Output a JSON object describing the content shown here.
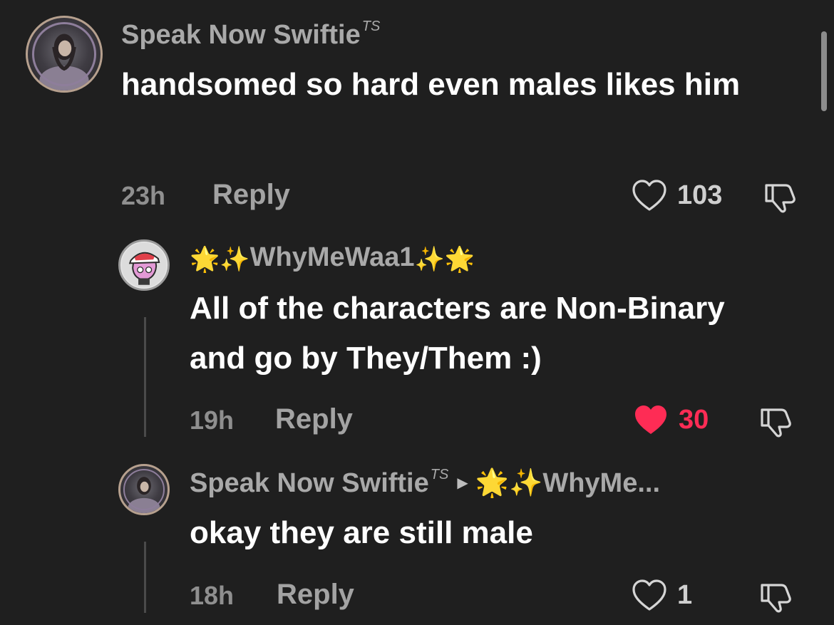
{
  "comments": [
    {
      "username": "Speak Now Swiftie",
      "badge": "TS",
      "text": "handsomed so hard even males likes him",
      "time": "23h",
      "reply_label": "Reply",
      "likes": "103",
      "liked": false
    },
    {
      "username_prefix": "🌟✨",
      "username": "WhyMeWaa1",
      "username_suffix": "✨🌟",
      "text": "All of the characters are Non-Binary and go by They/Them :)",
      "time": "19h",
      "reply_label": "Reply",
      "likes": "30",
      "liked": true
    },
    {
      "username": "Speak Now Swiftie",
      "badge": "TS",
      "reply_to": "🌟✨WhyMe...",
      "text": "okay they are still male",
      "time": "18h",
      "reply_label": "Reply",
      "likes": "1",
      "liked": false
    }
  ],
  "colors": {
    "background": "#1f1f1f",
    "text": "#ffffff",
    "muted": "#a9a9a9",
    "liked": "#fe2c55"
  },
  "icons": [
    "heart-outline-icon",
    "heart-filled-icon",
    "dislike-icon",
    "reply-caret-icon"
  ]
}
